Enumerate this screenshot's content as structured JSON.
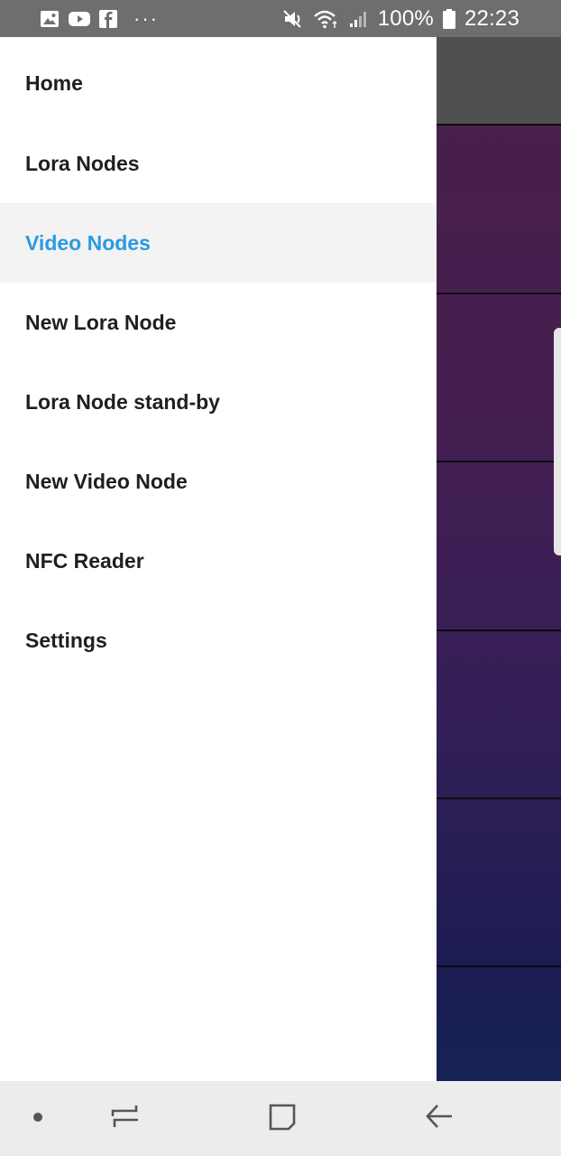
{
  "status_bar": {
    "notification_icons": [
      "gallery-icon",
      "youtube-icon",
      "facebook-icon"
    ],
    "more_indicator": "···",
    "battery_percent": "100%",
    "time": "22:23"
  },
  "drawer": {
    "items": [
      {
        "label": "Home",
        "active": false
      },
      {
        "label": "Lora Nodes",
        "active": false
      },
      {
        "label": "Video Nodes",
        "active": true
      },
      {
        "label": "New Lora Node",
        "active": false
      },
      {
        "label": "Lora Node stand-by",
        "active": false
      },
      {
        "label": "New Video Node",
        "active": false
      },
      {
        "label": "NFC Reader",
        "active": false
      },
      {
        "label": "Settings",
        "active": false
      }
    ],
    "accent_color": "#2a9ae3"
  },
  "nav_bar": {
    "buttons": [
      "dot-icon",
      "recents-icon",
      "home-icon",
      "back-icon"
    ]
  }
}
